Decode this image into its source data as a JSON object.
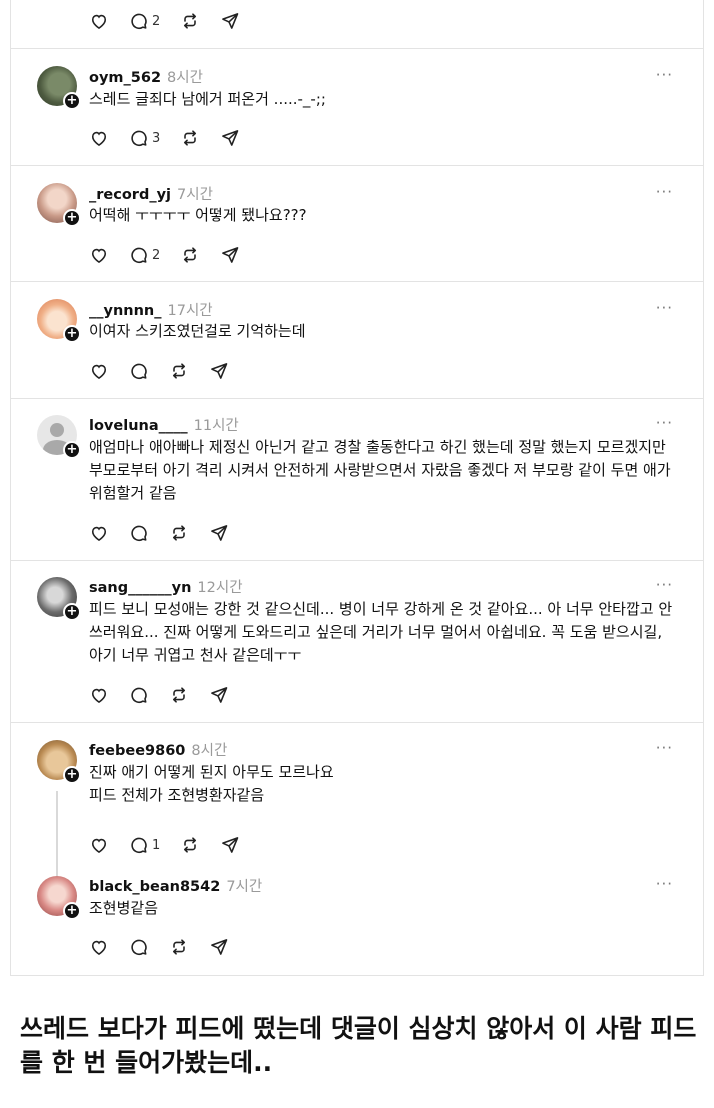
{
  "posts": [
    {
      "user": "",
      "time": "",
      "text": "",
      "comments": "2"
    },
    {
      "user": "oym_562",
      "time": "8시간",
      "text": "스레드 글죄다 남에거 퍼온거 .....-_-;;",
      "comments": "3"
    },
    {
      "user": "_record_yj",
      "time": "7시간",
      "text": "어떡해 ㅜㅜㅜㅜ 어떻게 됐나요???",
      "comments": "2"
    },
    {
      "user": "__ynnnn_",
      "time": "17시간",
      "text": "이여자 스키조였던걸로 기억하는데",
      "comments": ""
    },
    {
      "user": "loveluna____",
      "time": "11시간",
      "text": "애엄마나 애아빠나 제정신 아닌거 같고 경찰 출동한다고 하긴 했는데 정말 했는지 모르겠지만 부모로부터 아기 격리 시켜서 안전하게 사랑받으면서 자랐음 좋겠다 저 부모랑 같이 두면 애가 위험할거 같음",
      "comments": ""
    },
    {
      "user": "sang______yn",
      "time": "12시간",
      "text": "피드 보니 모성애는 강한 것 같으신데... 병이 너무 강하게 온 것 같아요... 아 너무 안타깝고 안쓰러워요... 진짜 어떻게 도와드리고 싶은데 거리가 너무 멀어서 아쉽네요. 꼭 도움 받으시길, 아기 너무 귀엽고 천사 같은데ㅜㅜ",
      "comments": ""
    },
    {
      "user": "feebee9860",
      "time": "8시간",
      "text": "진짜 애기 어떻게 된지 아무도 모르나요\n피드 전체가 조현병환자같음",
      "comments": "1"
    },
    {
      "user": "black_bean8542",
      "time": "7시간",
      "text": "조현병같음",
      "comments": ""
    }
  ],
  "more_label": "···",
  "plus_label": "+",
  "caption": "쓰레드 보다가 피드에 떴는데 댓글이 심상치 않아서 이 사람 피드를 한 번 들어가봤는데..",
  "colors": {
    "border": "#e3e3e3",
    "time": "#9a9a9a",
    "text": "#111111"
  }
}
